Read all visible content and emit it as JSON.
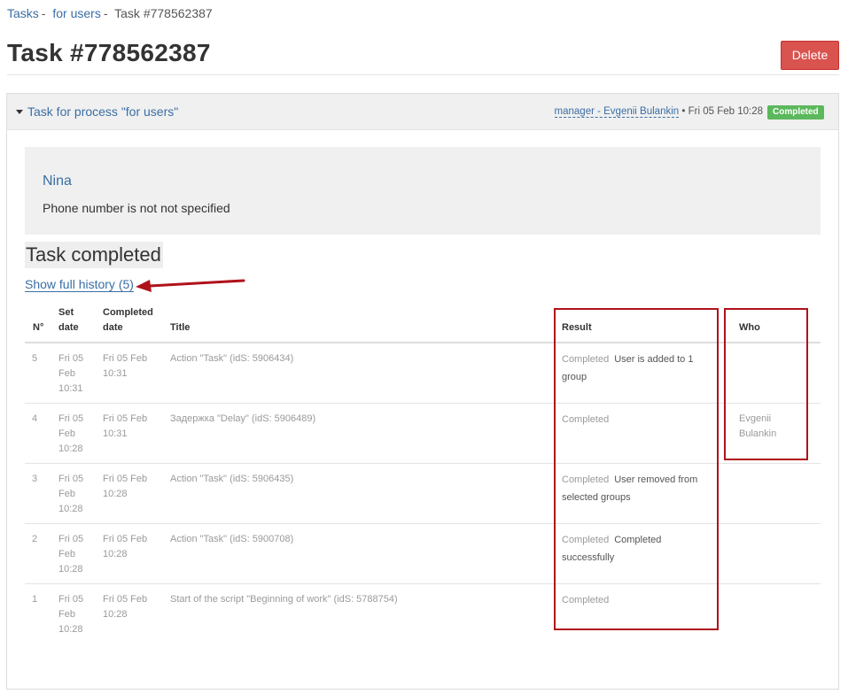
{
  "breadcrumb": {
    "items": [
      "Tasks",
      "for users"
    ],
    "separator": "-",
    "current": "Task #778562387"
  },
  "page": {
    "title": "Task #778562387",
    "delete_label": "Delete"
  },
  "panel": {
    "header_link": "Task for process \"for users\"",
    "manager": "manager - Evgenii Bulankin",
    "meta_sep": "•",
    "date": "Fri 05 Feb 10:28",
    "status_badge": "Completed",
    "status_color": "#5cb85c"
  },
  "contact": {
    "name": "Nina",
    "phone": "Phone number is not not specified"
  },
  "task": {
    "heading": "Task completed",
    "history_link": "Show full history (5)"
  },
  "table": {
    "headers": {
      "num": "N°",
      "set_date": "Set date",
      "completed_date": "Completed date",
      "title": "Title",
      "result": "Result",
      "who": "Who"
    },
    "rows": [
      {
        "num": "5",
        "set_date": "Fri 05 Feb 10:31",
        "completed_date": "Fri 05 Feb 10:31",
        "title": "Action \"Task\" (idS: 5906434)",
        "result_status": "Completed",
        "result_extra": "User is added to 1 group",
        "who": ""
      },
      {
        "num": "4",
        "set_date": "Fri 05 Feb 10:28",
        "completed_date": "Fri 05 Feb 10:31",
        "title": "Задержка \"Delay\" (idS: 5906489)",
        "result_status": "Completed",
        "result_extra": "",
        "who": "Evgenii Bulankin"
      },
      {
        "num": "3",
        "set_date": "Fri 05 Feb 10:28",
        "completed_date": "Fri 05 Feb 10:28",
        "title": "Action \"Task\" (idS: 5906435)",
        "result_status": "Completed",
        "result_extra": "User removed from selected groups",
        "who": ""
      },
      {
        "num": "2",
        "set_date": "Fri 05 Feb 10:28",
        "completed_date": "Fri 05 Feb 10:28",
        "title": "Action \"Task\" (idS: 5900708)",
        "result_status": "Completed",
        "result_extra": "Completed successfully",
        "who": ""
      },
      {
        "num": "1",
        "set_date": "Fri 05 Feb 10:28",
        "completed_date": "Fri 05 Feb 10:28",
        "title": "Start of the script \"Beginning of work\" (idS: 5788754)",
        "result_status": "Completed",
        "result_extra": "",
        "who": ""
      }
    ]
  },
  "annotations": {
    "highlight_color": "#b0121b",
    "arrow_icon": "arrow-left-icon"
  }
}
